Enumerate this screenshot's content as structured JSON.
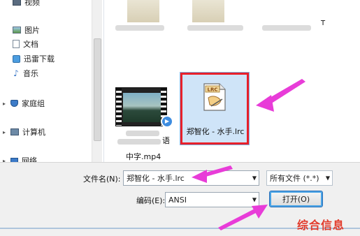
{
  "sidebar": {
    "items": [
      {
        "label": "视频",
        "icon": "video-icon"
      },
      {
        "label": "图片",
        "icon": "pictures-icon"
      },
      {
        "label": "文档",
        "icon": "documents-icon"
      },
      {
        "label": "迅雷下载",
        "icon": "download-icon"
      },
      {
        "label": "音乐",
        "icon": "music-icon"
      },
      {
        "label": "家庭组",
        "icon": "homegroup-icon"
      },
      {
        "label": "计算机",
        "icon": "computer-icon"
      },
      {
        "label": "网络",
        "icon": "network-icon"
      }
    ]
  },
  "files": {
    "selected": {
      "name": "郑智化 - 水手.lrc",
      "icon": "lrc-file-icon",
      "badge": "LRC"
    },
    "video": {
      "name_line1": "语",
      "name_line2": "中字.mp4",
      "icon": "video-file-icon"
    }
  },
  "top_right_letter": "T",
  "bottom": {
    "filename_label": "文件名(N):",
    "filename_value": "郑智化 - 水手.lrc",
    "filetype_value": "所有文件 (*.*)",
    "encoding_label": "编码(E):",
    "encoding_value": "ANSI",
    "open_button": "打开(O)"
  },
  "watermark": "综合信息",
  "colors": {
    "highlight_red": "#e8202a",
    "arrow_magenta": "#e83cd8",
    "selection_blue": "#cfe4f8"
  }
}
